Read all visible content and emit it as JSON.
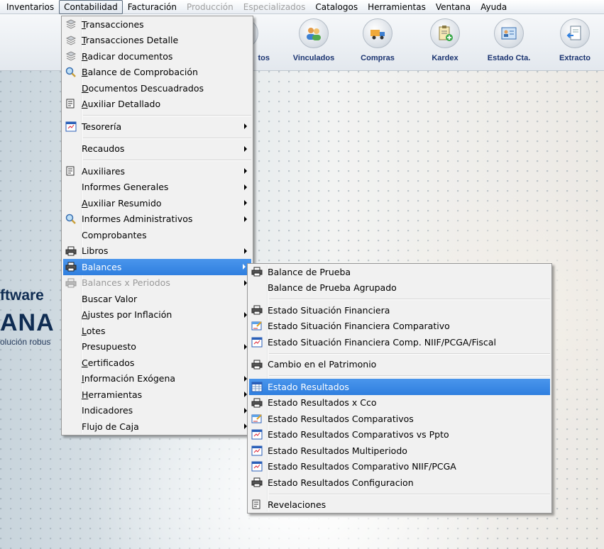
{
  "menubar": {
    "items": [
      "Inventarios",
      "Contabilidad",
      "Facturación",
      "Producción",
      "Especializados",
      "Catalogos",
      "Herramientas",
      "Ventana",
      "Ayuda"
    ]
  },
  "toolbar": {
    "partial_label": "tos",
    "buttons": [
      {
        "label": "Vinculados",
        "icon": "users-icon"
      },
      {
        "label": "Compras",
        "icon": "truck-icon"
      },
      {
        "label": "Kardex",
        "icon": "clipboard-add-icon"
      },
      {
        "label": "Estado Cta.",
        "icon": "id-card-icon"
      },
      {
        "label": "Extracto",
        "icon": "document-arrow-icon"
      }
    ]
  },
  "brand": {
    "line1": "ftware",
    "line2": "ANA",
    "line3": "olución robus"
  },
  "contabilidad_menu": {
    "items": [
      {
        "pre": "",
        "ul": "T",
        "post": "ransacciones"
      },
      {
        "pre": "",
        "ul": "T",
        "post": "ransacciones Detalle"
      },
      {
        "pre": "",
        "ul": "R",
        "post": "adicar documentos"
      },
      {
        "pre": "",
        "ul": "B",
        "post": "alance de Comprobación"
      },
      {
        "pre": "",
        "ul": "D",
        "post": "ocumentos Descuadrados"
      },
      {
        "pre": "",
        "ul": "A",
        "post": "uxiliar Detallado"
      },
      {
        "label": "Tesorería"
      },
      {
        "label": "Recaudos"
      },
      {
        "label": "Auxiliares"
      },
      {
        "label": "Informes Generales"
      },
      {
        "pre": "",
        "ul": "A",
        "post": "uxiliar Resumido"
      },
      {
        "label": "Informes Administrativos"
      },
      {
        "label": "Comprobantes"
      },
      {
        "label": "Libros"
      },
      {
        "label": "Balances"
      },
      {
        "label": "Balances x Periodos"
      },
      {
        "label": "Buscar Valor"
      },
      {
        "pre": "",
        "ul": "A",
        "post": "justes por Inflación"
      },
      {
        "pre": "",
        "ul": "L",
        "post": "otes"
      },
      {
        "label": "Presupuesto"
      },
      {
        "pre": "",
        "ul": "C",
        "post": "ertificados"
      },
      {
        "pre": "",
        "ul": "I",
        "post": "nformación Exógena"
      },
      {
        "pre": "",
        "ul": "H",
        "post": "erramientas"
      },
      {
        "label": "Indicadores"
      },
      {
        "label": "Flujo de Caja"
      }
    ]
  },
  "balances_submenu": {
    "items": [
      "Balance de Prueba",
      "Balance de Prueba Agrupado",
      "Estado Situación Financiera",
      "Estado Situación Financiera Comparativo",
      "Estado Situación Financiera Comp. NIIF/PCGA/Fiscal",
      "Cambio en el Patrimonio",
      "Estado Resultados",
      "Estado Resultados x Cco",
      "Estado Resultados Comparativos",
      "Estado Resultados Comparativos vs Ppto",
      "Estado Resultados Multiperiodo",
      "Estado Resultados Comparativo NIIF/PCGA",
      "Estado Resultados Configuracion",
      "Revelaciones"
    ]
  },
  "colors": {
    "highlight": "#3a88e6",
    "toolbar_label": "#1a3370",
    "brand": "#0f2c52"
  }
}
